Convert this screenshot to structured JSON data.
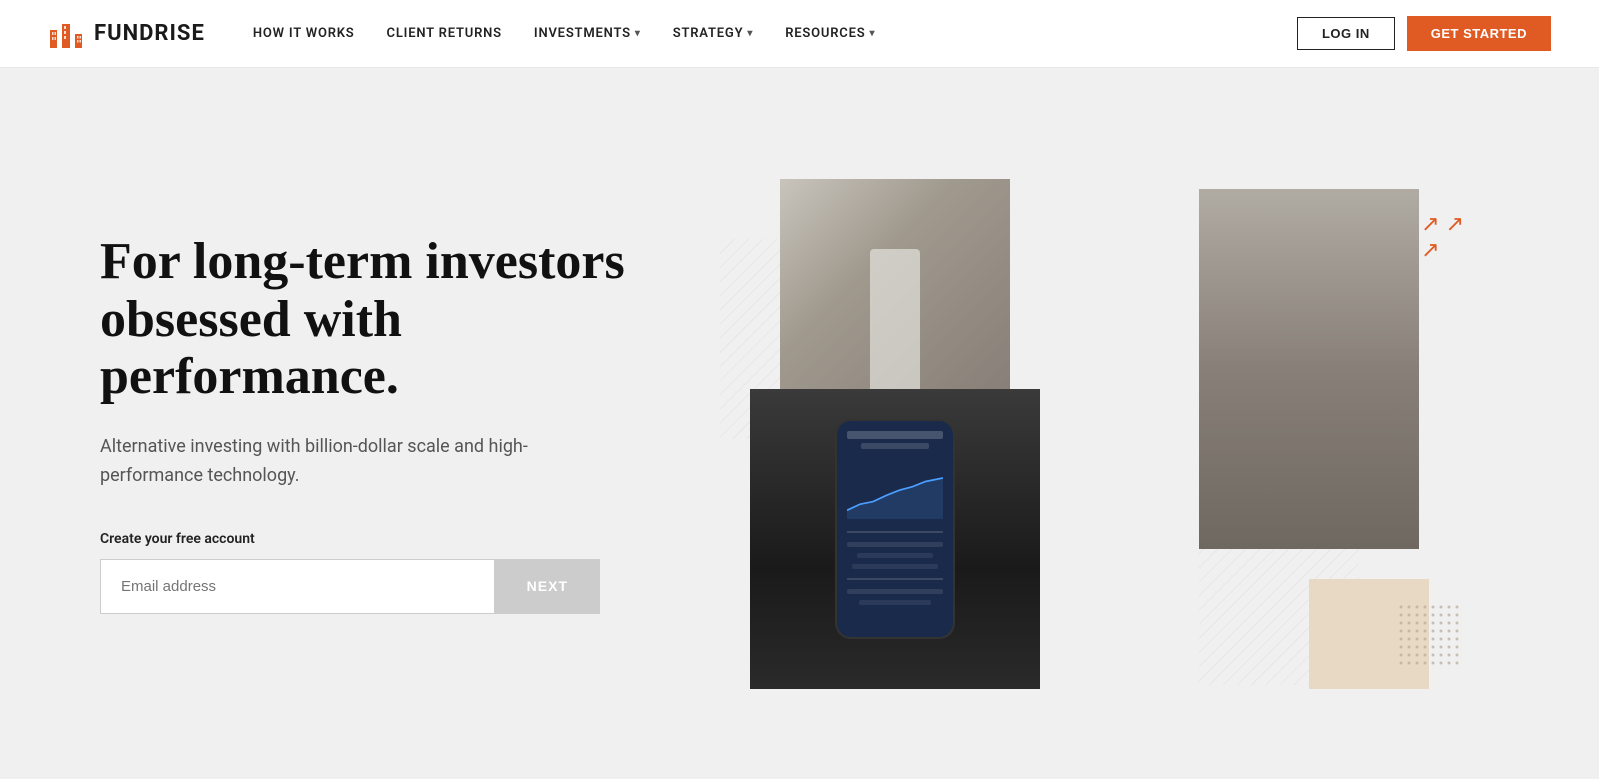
{
  "nav": {
    "logo_text": "FUNDRISE",
    "links": [
      {
        "label": "HOW IT WORKS",
        "has_dropdown": false
      },
      {
        "label": "CLIENT RETURNS",
        "has_dropdown": false
      },
      {
        "label": "INVESTMENTS",
        "has_dropdown": true
      },
      {
        "label": "STRATEGY",
        "has_dropdown": true
      },
      {
        "label": "RESOURCES",
        "has_dropdown": true
      }
    ],
    "login_label": "LOG IN",
    "cta_label": "GET STARTED"
  },
  "hero": {
    "heading": "For long-term investors obsessed with performance.",
    "subtext": "Alternative investing with billion-dollar scale and high-performance technology.",
    "form_label": "Create your free account",
    "email_placeholder": "Email address",
    "next_label": "NEXT"
  },
  "decorations": {
    "arrows_label": "trending-up-arrows"
  }
}
